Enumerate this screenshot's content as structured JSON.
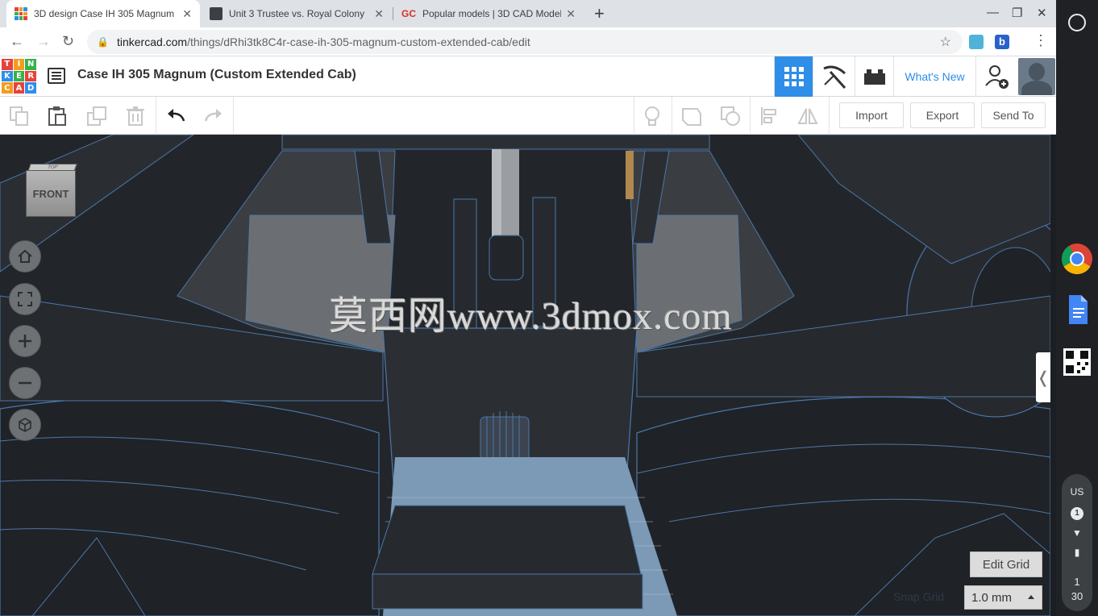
{
  "browser": {
    "tabs": [
      {
        "title": "3D design Case IH 305 Magnum (",
        "active": true
      },
      {
        "title": "Unit 3 Trustee vs. Royal Colony",
        "active": false
      },
      {
        "title": "Popular models | 3D CAD Model",
        "active": false,
        "favicon_text": "GC"
      }
    ],
    "new_tab": "+",
    "window_controls": {
      "minimize": "—",
      "restore": "❐",
      "close": "✕"
    },
    "url_host": "tinkercad.com",
    "url_path": "/things/dRhi3tk8C4r-case-ih-305-magnum-custom-extended-cab/edit"
  },
  "tinkercad": {
    "logo_letters": [
      "T",
      "I",
      "N",
      "K",
      "E",
      "R",
      "C",
      "A",
      "D"
    ],
    "design_title": "Case IH 305 Magnum (Custom Extended Cab)",
    "whats_new": "What's New",
    "toolbar": {
      "import": "Import",
      "export": "Export",
      "send_to": "Send To"
    },
    "viewcube": {
      "front": "FRONT",
      "top": "TOP"
    },
    "watermark": "莫西网www.3dmox.com",
    "edit_grid": "Edit Grid",
    "snap_grid_label": "Snap Grid",
    "snap_grid_value": "1.0 mm",
    "colors": {
      "accent": "#2e8ee8",
      "scene_bg": "#22262b",
      "edge": "#4d77a8"
    }
  },
  "shelf": {
    "locale": "US",
    "notifications": "1",
    "time_hour": "1",
    "time_minute": "30"
  }
}
